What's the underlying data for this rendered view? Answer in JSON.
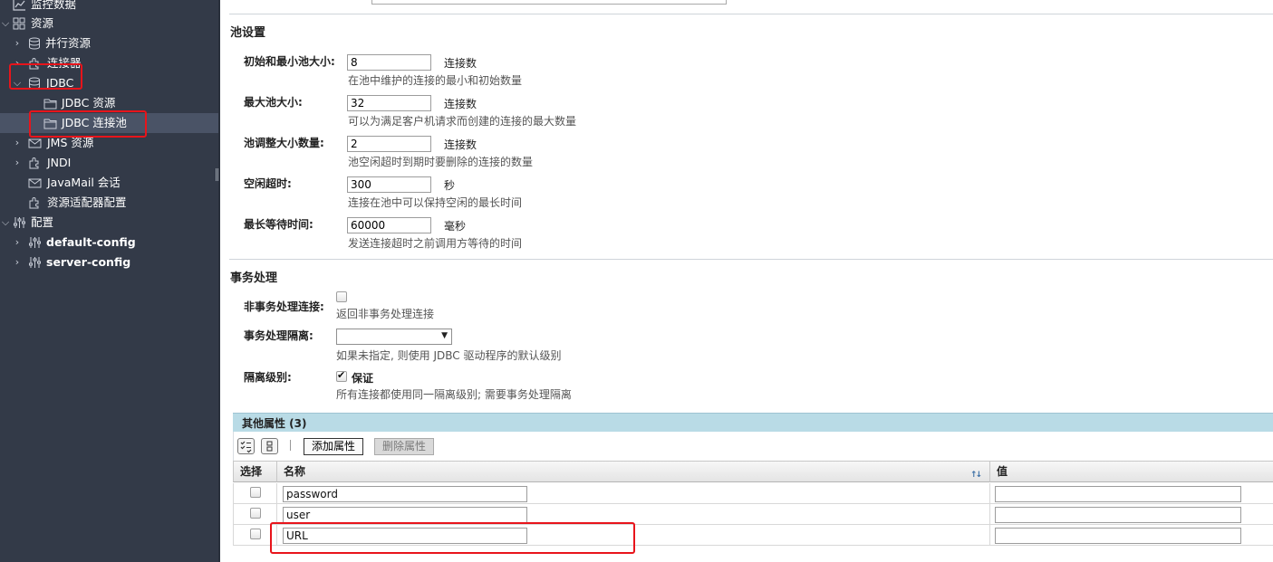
{
  "sidebar": {
    "items": [
      {
        "label": "监控数据",
        "icon": "chart-icon"
      },
      {
        "label": "资源",
        "icon": "resources-icon"
      },
      {
        "label": "并行资源",
        "icon": "database-icon"
      },
      {
        "label": "连接器",
        "icon": "puzzle-icon"
      },
      {
        "label": "JDBC",
        "icon": "database-icon"
      },
      {
        "label": "JDBC 资源",
        "icon": "folder-icon"
      },
      {
        "label": "JDBC 连接池",
        "icon": "folder-icon"
      },
      {
        "label": "JMS 资源",
        "icon": "envelope-icon"
      },
      {
        "label": "JNDI",
        "icon": "puzzle-icon"
      },
      {
        "label": "JavaMail 会话",
        "icon": "envelope-icon"
      },
      {
        "label": "资源适配器配置",
        "icon": "puzzle-icon"
      },
      {
        "label": "配置",
        "icon": "sliders-icon"
      },
      {
        "label": "default-config",
        "icon": "sliders-icon"
      },
      {
        "label": "server-config",
        "icon": "sliders-icon"
      }
    ]
  },
  "pool_settings": {
    "title": "池设置",
    "fields": [
      {
        "label": "初始和最小池大小:",
        "value": "8",
        "unit": "连接数",
        "help": "在池中维护的连接的最小和初始数量"
      },
      {
        "label": "最大池大小:",
        "value": "32",
        "unit": "连接数",
        "help": "可以为满足客户机请求而创建的连接的最大数量"
      },
      {
        "label": "池调整大小数量:",
        "value": "2",
        "unit": "连接数",
        "help": "池空闲超时到期时要删除的连接的数量"
      },
      {
        "label": "空闲超时:",
        "value": "300",
        "unit": "秒",
        "help": "连接在池中可以保持空闲的最长时间"
      },
      {
        "label": "最长等待时间:",
        "value": "60000",
        "unit": "毫秒",
        "help": "发送连接超时之前调用方等待的时间"
      }
    ]
  },
  "transaction": {
    "title": "事务处理",
    "non_tx_label": "非事务处理连接:",
    "non_tx_help": "返回非事务处理连接",
    "isolation_label": "事务处理隔离:",
    "isolation_value": "",
    "isolation_help": "如果未指定, 则使用 JDBC 驱动程序的默认级别",
    "level_label": "隔离级别:",
    "level_checkbox_label": "保证",
    "level_help": "所有连接都使用同一隔离级别; 需要事务处理隔离"
  },
  "additional_properties": {
    "title": "其他属性 (3)",
    "add_button": "添加属性",
    "delete_button": "删除属性",
    "columns": {
      "select": "选择",
      "name": "名称",
      "value": "值"
    },
    "rows": [
      {
        "name": "password",
        "value": ""
      },
      {
        "name": "user",
        "value": ""
      },
      {
        "name": "URL",
        "value": ""
      }
    ]
  },
  "colors": {
    "sidebar_bg": "#333a48",
    "annotation_red": "#e8141b",
    "table_header_bg": "#b9dbe6"
  }
}
